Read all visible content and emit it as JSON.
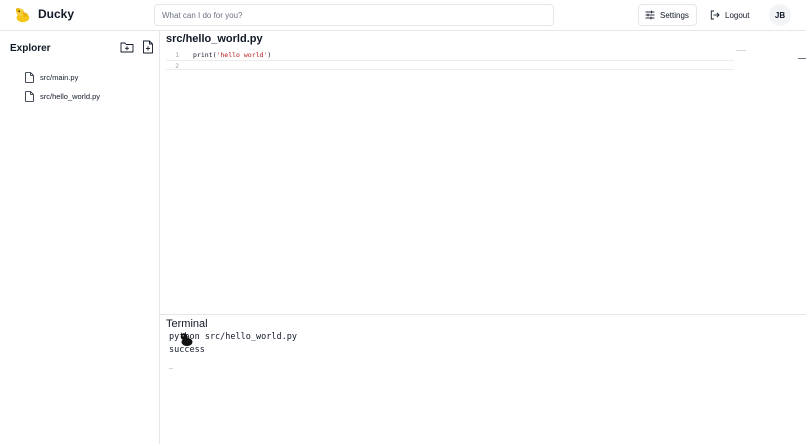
{
  "header": {
    "app_title": "Ducky",
    "logo_icon": "duck-logo-icon",
    "search_placeholder": "What can I do for you?",
    "settings_label": "Settings",
    "settings_icon": "sliders-icon",
    "logout_label": "Logout",
    "logout_icon": "logout-icon",
    "avatar_initials": "JB"
  },
  "sidebar": {
    "title": "Explorer",
    "actions": [
      "new-folder-icon",
      "new-file-icon"
    ],
    "files": [
      {
        "name": "src/main.py",
        "icon": "file-icon"
      },
      {
        "name": "src/hello_world.py",
        "icon": "file-icon"
      }
    ]
  },
  "editor": {
    "title": "src/hello_world.py",
    "lines": [
      {
        "number": "1",
        "code_prefix": "print(",
        "code_string": "'hello world'",
        "code_suffix": ")"
      },
      {
        "number": "2",
        "code_prefix": "",
        "code_string": "",
        "code_suffix": ""
      }
    ]
  },
  "terminal": {
    "title": "Terminal",
    "command": "python src/hello_world.py",
    "output": "success",
    "prompt": "_"
  },
  "colors": {
    "border": "#e5e7eb",
    "string": "#b91c1c",
    "text": "#111827",
    "muted": "#6b7280",
    "logo": "#f5c518"
  }
}
